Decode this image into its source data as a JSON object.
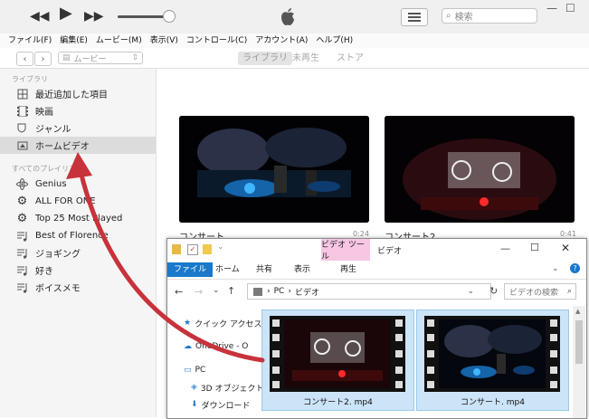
{
  "itunes": {
    "search_placeholder": "検索",
    "menu": [
      "ファイル(F)",
      "編集(E)",
      "ムービー(M)",
      "表示(V)",
      "コントロール(C)",
      "アカウント(A)",
      "ヘルプ(H)"
    ],
    "media_select": "ムービー",
    "tabs": [
      "ライブラリ",
      "未再生",
      "ストア"
    ],
    "sidebar": {
      "library_header": "ライブラリ",
      "library_items": [
        "最近追加した項目",
        "映画",
        "ジャンル",
        "ホームビデオ"
      ],
      "playlists_header": "すべてのプレイリスト",
      "playlist_items": [
        "Genius",
        "ALL FOR ONE",
        "Top 25 Most Played",
        "Best of Florence",
        "ジョギング",
        "好き",
        "ボイスメモ"
      ]
    },
    "videos": [
      {
        "title": "コンサート",
        "duration": "0:24"
      },
      {
        "title": "コンサート2",
        "duration": "0:41"
      }
    ]
  },
  "explorer": {
    "title_context_tab": "ビデオ ツール",
    "title": "ビデオ",
    "ribbon_tabs": [
      "ファイル",
      "ホーム",
      "共有",
      "表示",
      "再生"
    ],
    "breadcrumb": [
      "PC",
      "ビデオ"
    ],
    "search_placeholder": "ビデオの検索",
    "nav_items": [
      "クイック アクセス",
      "OneDrive - O",
      "PC",
      "3D オブジェクト",
      "ダウンロード"
    ],
    "files": [
      "コンサート2. mp4",
      "コンサート. mp4"
    ]
  },
  "colors": {
    "accent_arrow": "#c8323b",
    "ribbon_file": "#1979ca",
    "video_tools_tab": "#f6c6e3",
    "selection": "#cce4f7"
  }
}
